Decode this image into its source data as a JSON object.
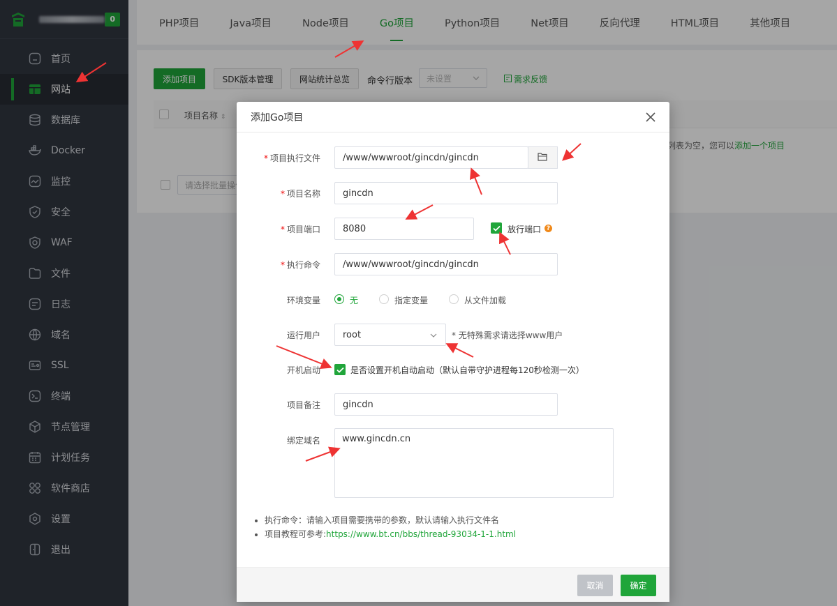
{
  "colors": {
    "accent": "#20a53a",
    "sidebar_bg": "#313640",
    "annotation_red": "#ee3333",
    "warning": "#f0891a"
  },
  "sidebar": {
    "alert_count": "0",
    "items": [
      {
        "label": "首页",
        "icon": "home-icon"
      },
      {
        "label": "网站",
        "icon": "website-icon",
        "active": true
      },
      {
        "label": "数据库",
        "icon": "database-icon"
      },
      {
        "label": "Docker",
        "icon": "docker-icon"
      },
      {
        "label": "监控",
        "icon": "monitor-icon"
      },
      {
        "label": "安全",
        "icon": "shield-icon"
      },
      {
        "label": "WAF",
        "icon": "waf-icon"
      },
      {
        "label": "文件",
        "icon": "folder-icon"
      },
      {
        "label": "日志",
        "icon": "log-icon"
      },
      {
        "label": "域名",
        "icon": "globe-icon"
      },
      {
        "label": "SSL",
        "icon": "ssl-icon"
      },
      {
        "label": "终端",
        "icon": "terminal-icon"
      },
      {
        "label": "节点管理",
        "icon": "node-icon"
      },
      {
        "label": "计划任务",
        "icon": "calendar-icon"
      },
      {
        "label": "软件商店",
        "icon": "apps-icon"
      },
      {
        "label": "设置",
        "icon": "settings-icon"
      },
      {
        "label": "退出",
        "icon": "logout-icon"
      }
    ]
  },
  "tabs": [
    "PHP项目",
    "Java项目",
    "Node项目",
    "Go项目",
    "Python项目",
    "Net项目",
    "反向代理",
    "HTML项目",
    "其他项目"
  ],
  "active_tab": "Go项目",
  "toolbar": {
    "add_project": "添加项目",
    "sdk_manage": "SDK版本管理",
    "site_stats": "网站统计总览",
    "cmd_version_label": "命令行版本",
    "cmd_version_value": "未设置",
    "feedback": "需求反馈"
  },
  "table": {
    "col_name": "项目名称",
    "empty_prefix": "列表为空，您可以",
    "empty_link": "添加一个项目",
    "batch_placeholder": "请选择批量操作"
  },
  "modal": {
    "title": "添加Go项目",
    "fields": {
      "exec_file": {
        "label": "项目执行文件",
        "value": "/www/wwwroot/gincdn/gincdn"
      },
      "name": {
        "label": "项目名称",
        "value": "gincdn"
      },
      "port": {
        "label": "项目端口",
        "value": "8080"
      },
      "open_port": {
        "label": "放行端口",
        "checked": true
      },
      "command": {
        "label": "执行命令",
        "value": "/www/wwwroot/gincdn/gincdn"
      },
      "env": {
        "label": "环境变量",
        "options": [
          "无",
          "指定变量",
          "从文件加载"
        ],
        "selected": "无"
      },
      "run_user": {
        "label": "运行用户",
        "value": "root",
        "hint": "* 无特殊需求请选择www用户"
      },
      "autostart": {
        "label": "开机启动",
        "text": "是否设置开机自动启动（默认自带守护进程每120秒检测一次）",
        "checked": true
      },
      "remark": {
        "label": "项目备注",
        "value": "gincdn"
      },
      "domain": {
        "label": "绑定域名",
        "value": "www.gincdn.cn"
      }
    },
    "tips": [
      {
        "text": "执行命令：请输入项目需要携带的参数，默认请输入执行文件名"
      },
      {
        "text": "项目教程可参考:",
        "link": "https://www.bt.cn/bbs/thread-93034-1-1.html"
      }
    ],
    "cancel": "取消",
    "confirm": "确定"
  }
}
